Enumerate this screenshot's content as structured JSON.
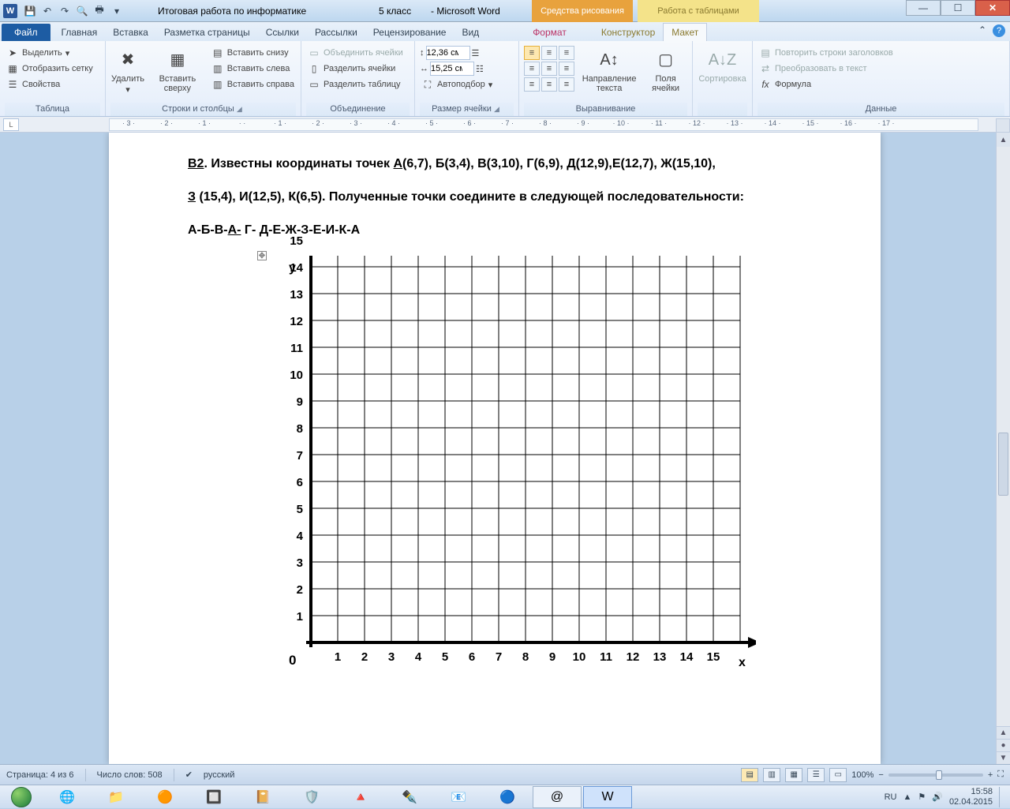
{
  "title": {
    "document": "Итоговая работа по информатике",
    "class_label": "5 класс",
    "app": "Microsoft Word",
    "sep": "-",
    "context_drawing": "Средства рисования",
    "context_table": "Работа с таблицами"
  },
  "tabs": {
    "file": "Файл",
    "home": "Главная",
    "insert": "Вставка",
    "layout": "Разметка страницы",
    "references": "Ссылки",
    "mailings": "Рассылки",
    "review": "Рецензирование",
    "view": "Вид",
    "format": "Формат",
    "designer": "Конструктор",
    "maket": "Макет"
  },
  "ribbon": {
    "table_group": "Таблица",
    "select": "Выделить",
    "show_grid": "Отобразить сетку",
    "properties": "Свойства",
    "rows_cols_group": "Строки и столбцы",
    "delete": "Удалить",
    "insert_top": "Вставить сверху",
    "insert_bottom": "Вставить снизу",
    "insert_left": "Вставить слева",
    "insert_right": "Вставить справа",
    "merge_group": "Объединение",
    "merge_cells": "Объединить ячейки",
    "split_cells": "Разделить ячейки",
    "split_table": "Разделить таблицу",
    "cell_size_group": "Размер ячейки",
    "height_val": "12,36 см",
    "width_val": "15,25 см",
    "autofit": "Автоподбор",
    "alignment_group": "Выравнивание",
    "text_direction": "Направление текста",
    "cell_margins": "Поля ячейки",
    "data_group": "Данные",
    "sort": "Сортировка",
    "repeat_header": "Повторить строки заголовков",
    "convert_text": "Преобразовать в текст",
    "formula": "Формула"
  },
  "ruler": {
    "marks": [
      "3",
      "2",
      "1",
      "",
      "1",
      "2",
      "3",
      "4",
      "5",
      "6",
      "7",
      "8",
      "9",
      "10",
      "11",
      "12",
      "13",
      "14",
      "15",
      "16",
      "17"
    ]
  },
  "doc": {
    "p1a": "В2",
    "p1b": ". Известны координаты точек ",
    "p1c": "А",
    "p1d": "(6,7), Б(3,4), В(3,10), Г(6,9), Д(12,9),Е(12,7), Ж(15,10),",
    "p2a": "З",
    "p2b": " (15,4), И(12,5), К(6,5). Полученные точки соедините в следующей последовательности:",
    "p3a": "А-Б-В-",
    "p3b": "А-",
    "p3c": " Г- Д-Е-Ж-З-Е-И-К-А"
  },
  "chart_data": {
    "type": "scatter",
    "title": "",
    "xlabel": "x",
    "ylabel": "y",
    "xlim": [
      0,
      16
    ],
    "ylim": [
      0,
      16
    ],
    "xticks": [
      1,
      2,
      3,
      4,
      5,
      6,
      7,
      8,
      9,
      10,
      11,
      12,
      13,
      14,
      15
    ],
    "yticks": [
      1,
      2,
      3,
      4,
      5,
      6,
      7,
      8,
      9,
      10,
      11,
      12,
      13,
      14,
      15
    ],
    "origin": "0",
    "series": [
      {
        "name": "А",
        "x": 6,
        "y": 7
      },
      {
        "name": "Б",
        "x": 3,
        "y": 4
      },
      {
        "name": "В",
        "x": 3,
        "y": 10
      },
      {
        "name": "Г",
        "x": 6,
        "y": 9
      },
      {
        "name": "Д",
        "x": 12,
        "y": 9
      },
      {
        "name": "Е",
        "x": 12,
        "y": 7
      },
      {
        "name": "Ж",
        "x": 15,
        "y": 10
      },
      {
        "name": "З",
        "x": 15,
        "y": 4
      },
      {
        "name": "И",
        "x": 12,
        "y": 5
      },
      {
        "name": "К",
        "x": 6,
        "y": 5
      }
    ],
    "path_order": [
      "А",
      "Б",
      "В",
      "А",
      "Г",
      "Д",
      "Е",
      "Ж",
      "З",
      "Е",
      "И",
      "К",
      "А"
    ]
  },
  "status": {
    "page": "Страница: 4 из 6",
    "words": "Число слов: 508",
    "language": "русский",
    "zoom": "100%"
  },
  "tray": {
    "lang": "RU",
    "time": "15:58",
    "date": "02.04.2015"
  }
}
